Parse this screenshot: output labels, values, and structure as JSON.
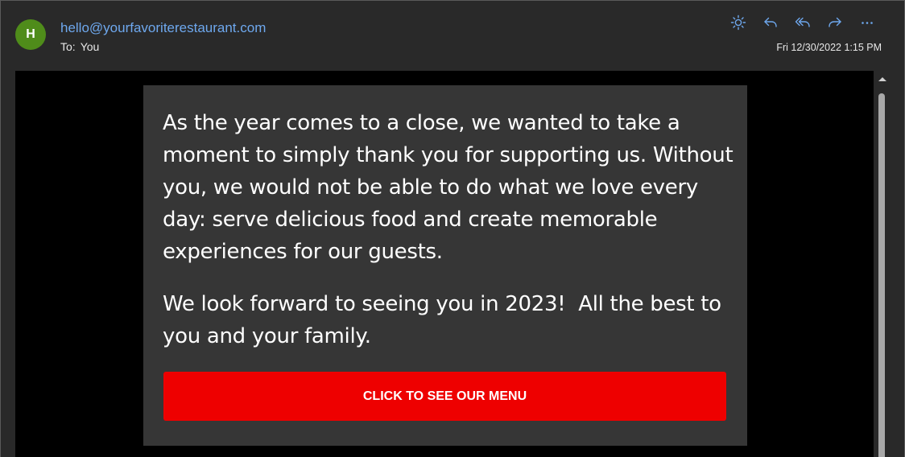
{
  "header": {
    "avatar_initial": "H",
    "avatar_color": "#4f8c1a",
    "sender_email": "hello@yourfavoriterestaurant.com",
    "to_label": "To:",
    "to_value": "You",
    "date": "Fri 12/30/2022 1:15 PM",
    "actions": [
      {
        "icon": "sun-icon",
        "label": "Switch background"
      },
      {
        "icon": "reply-icon",
        "label": "Reply"
      },
      {
        "icon": "reply-all-icon",
        "label": "Reply all"
      },
      {
        "icon": "forward-icon",
        "label": "Forward"
      },
      {
        "icon": "more-icon",
        "label": "More actions"
      }
    ],
    "accent_color": "#6ea8ee"
  },
  "message": {
    "paragraph_1": "As the year comes to a close, we wanted to take a moment to simply thank you for supporting us. Without you, we would not be able to do what we love every day: serve delicious food and create memorable experiences for our guests.",
    "paragraph_2": "We look forward to seeing you in 2023!  All the best to you and your family.",
    "cta_label": "CLICK TO SEE OUR MENU",
    "cta_color": "#ee0000"
  }
}
